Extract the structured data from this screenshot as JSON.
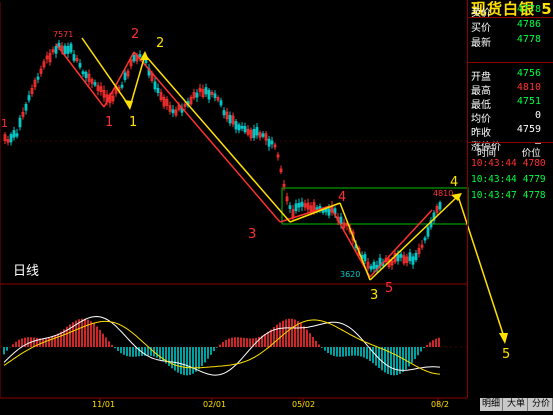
{
  "colors": {
    "up": "#ff3030",
    "down": "#00c8c8",
    "wave": "#ffe000",
    "grid": "#8a0000",
    "box": "#00c000"
  },
  "panel": {
    "title": "现货白银 5",
    "quotes": [
      {
        "label": "卖价",
        "value": "4778",
        "color": "#00ff40"
      },
      {
        "label": "买价",
        "value": "4786",
        "color": "#00ff40"
      },
      {
        "label": "最新",
        "value": "4778",
        "color": "#00ff40"
      },
      {
        "label": "开盘",
        "value": "4756",
        "color": "#00ff40"
      },
      {
        "label": "最高",
        "value": "4810",
        "color": "#ff3030"
      },
      {
        "label": "最低",
        "value": "4751",
        "color": "#00ff40"
      },
      {
        "label": "均价",
        "value": "0",
        "color": "#ffffff"
      },
      {
        "label": "昨收",
        "value": "4759",
        "color": "#ffffff"
      },
      {
        "label": "涨停价",
        "value": "—",
        "color": "#ffffff"
      }
    ],
    "trades_header": {
      "time": "时间",
      "price": "价位"
    },
    "trades": [
      {
        "time": "10:43:44",
        "price": "4780",
        "color": "#ff3030"
      },
      {
        "time": "10:43:44",
        "price": "4779",
        "color": "#00ff40"
      },
      {
        "time": "10:43:47",
        "price": "4778",
        "color": "#00ff40"
      }
    ],
    "tabs": [
      "明细",
      "大单",
      "分价"
    ]
  },
  "chart_data": {
    "type": "candlestick",
    "period_label": "日线",
    "x_ticks": [
      "11/01",
      "02/01",
      "05/02",
      "08/2"
    ],
    "edge_label": "1",
    "price_annotations": [
      "7571",
      "3620",
      "4810"
    ],
    "wave_labels": [
      {
        "text": "2",
        "color": "red"
      },
      {
        "text": "2",
        "color": "yellow"
      },
      {
        "text": "1",
        "color": "red"
      },
      {
        "text": "1",
        "color": "yellow"
      },
      {
        "text": "3",
        "color": "red"
      },
      {
        "text": "4",
        "color": "red"
      },
      {
        "text": "5",
        "color": "red"
      },
      {
        "text": "3",
        "color": "yellow"
      },
      {
        "text": "4",
        "color": "yellow"
      },
      {
        "text": "5",
        "color": "yellow"
      }
    ]
  }
}
